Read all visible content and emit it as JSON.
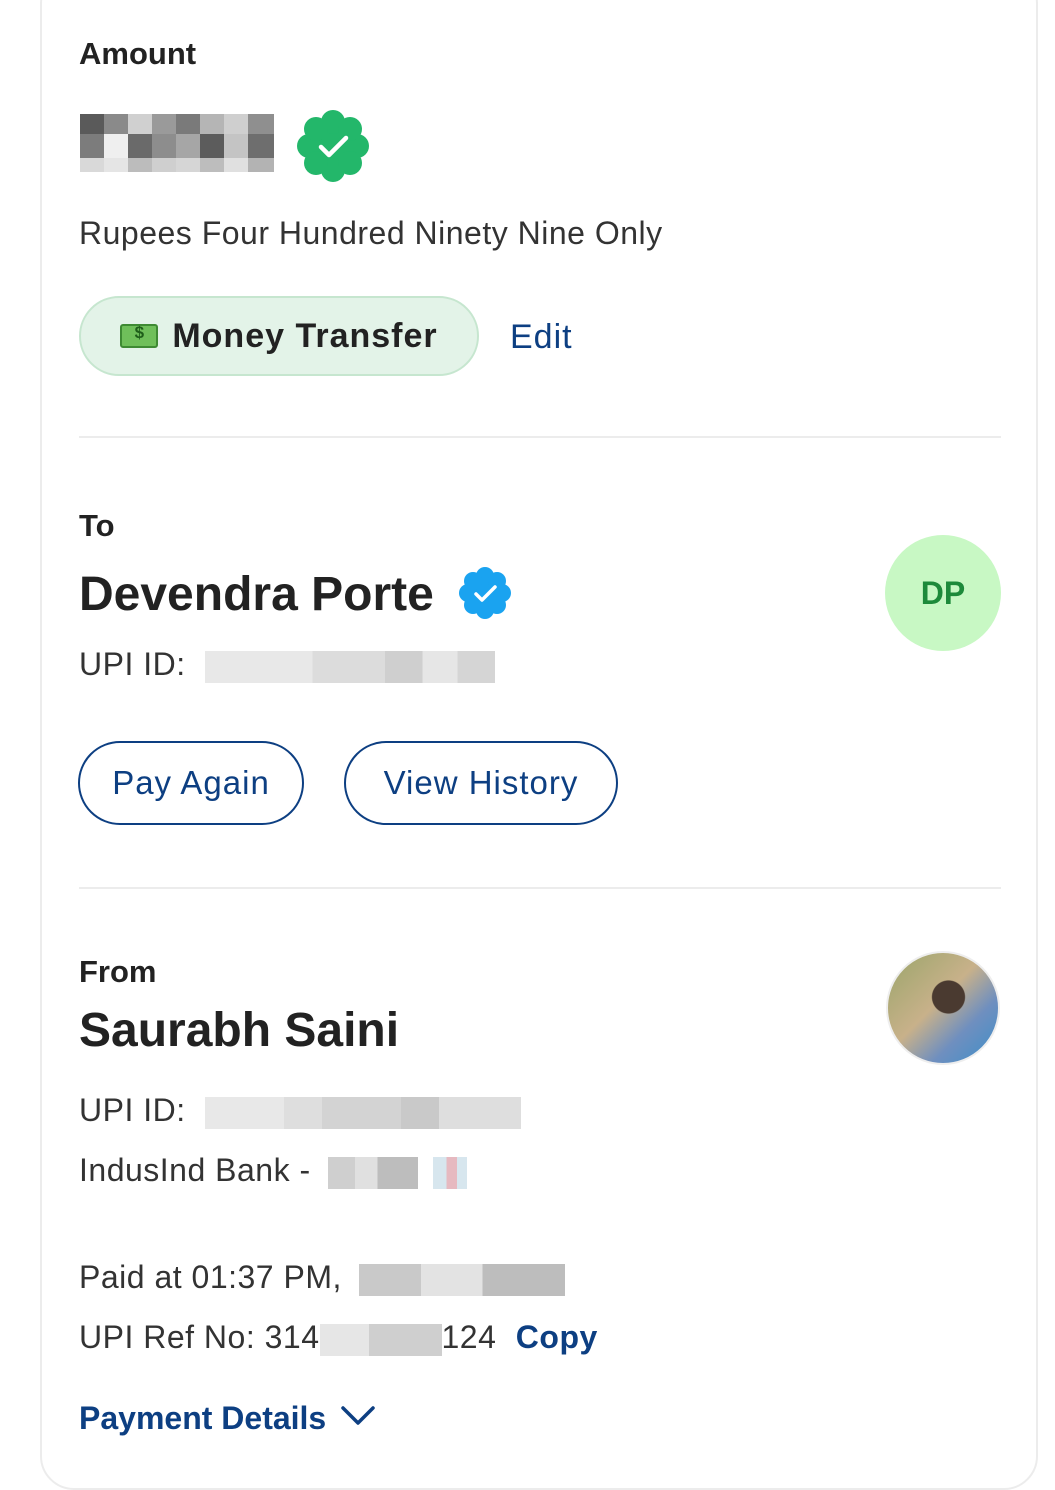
{
  "amount": {
    "label": "Amount",
    "words": "Rupees Four Hundred Ninety Nine Only",
    "category_chip": "Money Transfer",
    "edit_label": "Edit"
  },
  "to": {
    "label": "To",
    "name": "Devendra Porte",
    "upi_label": "UPI ID:",
    "avatar_initials": "DP",
    "pay_again_label": "Pay Again",
    "view_history_label": "View History"
  },
  "from": {
    "label": "From",
    "name": "Saurabh Saini",
    "upi_label": "UPI ID:",
    "bank_label": "IndusInd Bank -",
    "paid_at": "Paid at 01:37 PM,",
    "ref_prefix": "UPI Ref No: 314",
    "ref_suffix": "124",
    "copy_label": "Copy"
  },
  "payment_details_label": "Payment Details",
  "colors": {
    "accent_blue": "#0d3f82",
    "success_green": "#23b76a",
    "verified_blue": "#1aa3f0",
    "chip_bg": "#e3f3e8",
    "avatar_bg": "#c8f8c4"
  },
  "icons": [
    "check-badge-icon",
    "money-icon",
    "verified-badge-icon",
    "chevron-down-icon"
  ]
}
